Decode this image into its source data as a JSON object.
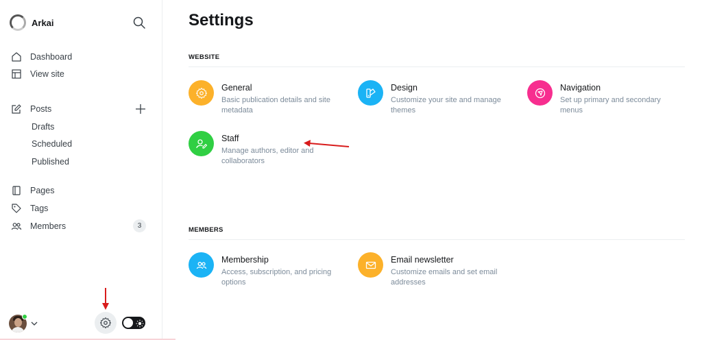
{
  "sidebar": {
    "brand": "Arkai",
    "nav": {
      "dashboard": "Dashboard",
      "view_site": "View site",
      "posts": "Posts",
      "drafts": "Drafts",
      "scheduled": "Scheduled",
      "published": "Published",
      "pages": "Pages",
      "tags": "Tags",
      "members": "Members",
      "members_count": "3"
    }
  },
  "main": {
    "title": "Settings",
    "sections": {
      "website": {
        "heading": "WEBSITE",
        "cards": {
          "general": {
            "title": "General",
            "desc": "Basic publication details and site metadata",
            "color": "#fcb12a"
          },
          "design": {
            "title": "Design",
            "desc": "Customize your site and manage themes",
            "color": "#1bb3f5"
          },
          "navigation": {
            "title": "Navigation",
            "desc": "Set up primary and secondary menus",
            "color": "#f72e8f"
          },
          "staff": {
            "title": "Staff",
            "desc": "Manage authors, editor and collaborators",
            "color": "#30cf43"
          }
        }
      },
      "members": {
        "heading": "MEMBERS",
        "cards": {
          "membership": {
            "title": "Membership",
            "desc": "Access, subscription, and pricing options",
            "color": "#1bb3f5"
          },
          "email_newsletter": {
            "title": "Email newsletter",
            "desc": "Customize emails and set email addresses",
            "color": "#fcb12a"
          }
        }
      }
    }
  },
  "icons": {
    "search": "search-icon",
    "home": "home-icon",
    "view_site": "layout-icon",
    "posts": "edit-icon",
    "pages": "page-icon",
    "tags": "tag-icon",
    "members": "members-icon",
    "settings": "gear-icon",
    "theme_toggle": "sun-icon"
  },
  "annotations": {
    "arrow_color": "#d81b1b"
  }
}
